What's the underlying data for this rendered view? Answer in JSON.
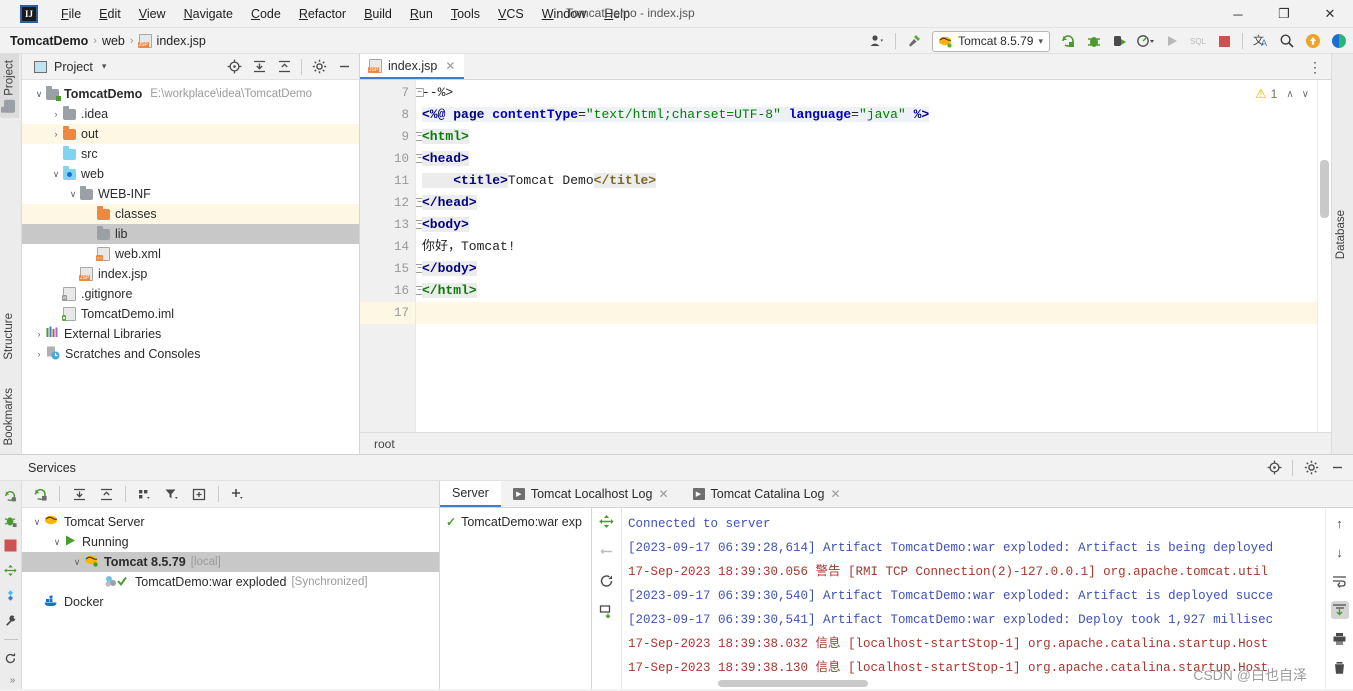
{
  "window": {
    "title": "TomcatDemo - index.jsp",
    "minimize": "─",
    "maximize": "❐",
    "close": "✕",
    "logo_text": "IJ"
  },
  "menubar": {
    "items": [
      "File",
      "Edit",
      "View",
      "Navigate",
      "Code",
      "Refactor",
      "Build",
      "Run",
      "Tools",
      "VCS",
      "Window",
      "Help"
    ]
  },
  "breadcrumb": {
    "project": "TomcatDemo",
    "folder": "web",
    "file": "index.jsp",
    "separator": "›",
    "file_badge": "JSP"
  },
  "toolbar": {
    "run_config": "Tomcat 8.5.79",
    "dropdown_caret": "▾",
    "icons": [
      "user-avatar-icon",
      "hammer-build-icon",
      "rerun-icon",
      "debug-icon",
      "run-with-coverage-icon",
      "profiler-icon",
      "run-icon",
      "sql-icon",
      "stop-icon",
      "translate-icon",
      "search-everywhere-icon",
      "update-icon",
      "ide-feature-icon"
    ]
  },
  "sidebar_left": {
    "top_tab": "Project",
    "bottom_tabs": [
      "Structure",
      "Bookmarks"
    ]
  },
  "sidebar_right": {
    "tab": "Database"
  },
  "project_panel": {
    "title": "Project",
    "caret": "▾",
    "header_icons": [
      "locate-icon",
      "expand-all-icon",
      "collapse-all-icon",
      "gear-icon",
      "hide-icon"
    ],
    "tree": [
      {
        "label": "TomcatDemo",
        "path": "E:\\workplace\\idea\\TomcatDemo",
        "depth": 0,
        "twist": "∨",
        "icon": "module-folder-icon",
        "bold": true,
        "highlight": "none"
      },
      {
        "label": ".idea",
        "path": "",
        "depth": 1,
        "twist": "›",
        "icon": "folder-gray-icon",
        "bold": false,
        "highlight": "none"
      },
      {
        "label": "out",
        "path": "",
        "depth": 1,
        "twist": "›",
        "icon": "folder-orange-icon",
        "bold": false,
        "highlight": "yellow"
      },
      {
        "label": "src",
        "path": "",
        "depth": 1,
        "twist": "",
        "icon": "folder-blue-icon",
        "bold": false,
        "highlight": "none"
      },
      {
        "label": "web",
        "path": "",
        "depth": 1,
        "twist": "∨",
        "icon": "web-root-icon",
        "bold": false,
        "highlight": "none"
      },
      {
        "label": "WEB-INF",
        "path": "",
        "depth": 2,
        "twist": "∨",
        "icon": "folder-gray-icon",
        "bold": false,
        "highlight": "none"
      },
      {
        "label": "classes",
        "path": "",
        "depth": 3,
        "twist": "",
        "icon": "folder-orange-icon",
        "bold": false,
        "highlight": "yellow"
      },
      {
        "label": "lib",
        "path": "",
        "depth": 3,
        "twist": "",
        "icon": "folder-gray-icon",
        "bold": false,
        "highlight": "gray"
      },
      {
        "label": "web.xml",
        "path": "",
        "depth": 3,
        "twist": "",
        "icon": "xml-file-icon",
        "bold": false,
        "highlight": "none"
      },
      {
        "label": "index.jsp",
        "path": "",
        "depth": 2,
        "twist": "",
        "icon": "jsp-file-icon",
        "bold": false,
        "highlight": "none"
      },
      {
        "label": ".gitignore",
        "path": "",
        "depth": 1,
        "twist": "",
        "icon": "gitignore-file-icon",
        "bold": false,
        "highlight": "none"
      },
      {
        "label": "TomcatDemo.iml",
        "path": "",
        "depth": 1,
        "twist": "",
        "icon": "iml-file-icon",
        "bold": false,
        "highlight": "none"
      },
      {
        "label": "External Libraries",
        "path": "",
        "depth": 0,
        "twist": "›",
        "icon": "libraries-icon",
        "bold": false,
        "highlight": "none"
      },
      {
        "label": "Scratches and Consoles",
        "path": "",
        "depth": 0,
        "twist": "›",
        "icon": "scratches-icon",
        "bold": false,
        "highlight": "none"
      }
    ]
  },
  "editor": {
    "tab_label": "index.jsp",
    "tab_close": "✕",
    "tab_badge": "JSP",
    "warning_count": "1",
    "warning_icon": "⚠",
    "nav_up": "∧",
    "nav_down": "∨",
    "more_icon": "⋮",
    "status_text": "root",
    "lines": [
      {
        "num": "7",
        "fold": "−",
        "current": false,
        "segments": [
          {
            "text": "--%>",
            "cls": "c-plain"
          }
        ]
      },
      {
        "num": "8",
        "fold": "",
        "current": false,
        "segments": [
          {
            "text": "<%@ ",
            "cls": "c-tag hlblock"
          },
          {
            "text": "page ",
            "cls": "c-tag hlblock"
          },
          {
            "text": "contentType",
            "cls": "c-attr hlblock"
          },
          {
            "text": "=",
            "cls": "c-plain hlblock"
          },
          {
            "text": "\"text/html;charset=UTF-8\"",
            "cls": "c-str hlblock"
          },
          {
            "text": " ",
            "cls": "c-plain hlblock"
          },
          {
            "text": "language",
            "cls": "c-attr hlblock"
          },
          {
            "text": "=",
            "cls": "c-plain hlblock"
          },
          {
            "text": "\"java\"",
            "cls": "c-str hlblock"
          },
          {
            "text": " %>",
            "cls": "c-tag hlblock"
          }
        ]
      },
      {
        "num": "9",
        "fold": "−",
        "current": false,
        "segments": [
          {
            "text": "<html>",
            "cls": "c-html hlblock2"
          }
        ]
      },
      {
        "num": "10",
        "fold": "−",
        "current": false,
        "segments": [
          {
            "text": "<head>",
            "cls": "c-tag hlblock2"
          }
        ]
      },
      {
        "num": "11",
        "fold": "",
        "current": false,
        "segments": [
          {
            "text": "    ",
            "cls": "c-plain hlblock2"
          },
          {
            "text": "<title>",
            "cls": "c-tag hlblock2"
          },
          {
            "text": "Tomcat Demo",
            "cls": "c-plain"
          },
          {
            "text": "</title>",
            "cls": "c-title hlblock2"
          }
        ]
      },
      {
        "num": "12",
        "fold": "−",
        "current": false,
        "segments": [
          {
            "text": "</head>",
            "cls": "c-tag hlblock2"
          }
        ]
      },
      {
        "num": "13",
        "fold": "−",
        "current": false,
        "segments": [
          {
            "text": "<body>",
            "cls": "c-tag hlblock2"
          }
        ]
      },
      {
        "num": "14",
        "fold": "",
        "current": false,
        "segments": [
          {
            "text": "你好，Tomcat!",
            "cls": "c-plain"
          }
        ]
      },
      {
        "num": "15",
        "fold": "−",
        "current": false,
        "segments": [
          {
            "text": "</body>",
            "cls": "c-tag hlblock2"
          }
        ]
      },
      {
        "num": "16",
        "fold": "−",
        "current": false,
        "segments": [
          {
            "text": "</html>",
            "cls": "c-html hlblock2"
          }
        ]
      },
      {
        "num": "17",
        "fold": "",
        "current": true,
        "segments": [
          {
            "text": "",
            "cls": "c-plain"
          }
        ]
      }
    ]
  },
  "services": {
    "title": "Services",
    "header_icons": [
      "locate-icon",
      "gear-icon",
      "hide-icon"
    ],
    "vstrip_icons": [
      "rerun-icon",
      "debug-icon",
      "stop-icon",
      "deploy-icon",
      "dashboard-icon",
      "settings-wrench-icon",
      "refresh-icon",
      "expand-icon"
    ],
    "toolbar_icons": [
      "rerun-icon",
      "expand-all-icon",
      "collapse-all-icon",
      "group-icon",
      "filter-icon",
      "new-tab-icon",
      "add-icon"
    ],
    "tree": [
      {
        "label": "Tomcat Server",
        "suffix": "",
        "depth": 0,
        "twist": "∨",
        "icon": "tomcat-icon",
        "bold": false,
        "selected": false
      },
      {
        "label": "Running",
        "suffix": "",
        "depth": 1,
        "twist": "∨",
        "icon": "running-play-icon",
        "bold": false,
        "selected": false
      },
      {
        "label": "Tomcat 8.5.79",
        "suffix": "[local]",
        "depth": 2,
        "twist": "∨",
        "icon": "tomcat-running-icon",
        "bold": true,
        "selected": true
      },
      {
        "label": "TomcatDemo:war exploded",
        "suffix": "[Synchronized]",
        "depth": 3,
        "twist": "",
        "icon": "artifact-ok-icon",
        "bold": false,
        "selected": false
      },
      {
        "label": "Docker",
        "suffix": "",
        "depth": 0,
        "twist": "",
        "icon": "docker-icon",
        "bold": false,
        "selected": false
      }
    ]
  },
  "console": {
    "tabs": [
      {
        "label": "Server",
        "active": true,
        "closable": false,
        "has_play": false
      },
      {
        "label": "Tomcat Localhost Log",
        "active": false,
        "closable": true,
        "has_play": true
      },
      {
        "label": "Tomcat Catalina Log",
        "active": false,
        "closable": true,
        "has_play": true
      }
    ],
    "left_item": "TomcatDemo:war exp",
    "vtools_icons": [
      "deploy-icon",
      "undeploy-icon",
      "restart-icon",
      "redeploy-icon"
    ],
    "right_icons": [
      "scroll-up-icon",
      "scroll-down-icon",
      "soft-wrap-icon",
      "scroll-to-end-icon",
      "print-icon",
      "delete-icon"
    ],
    "log_lines": [
      {
        "text": "Connected to server",
        "cls": "lg-blue"
      },
      {
        "text": "[2023-09-17 06:39:28,614] Artifact TomcatDemo:war exploded: Artifact is being deployed",
        "cls": "lg-blue"
      },
      {
        "text": "17-Sep-2023 18:39:30.056 警告 [RMI TCP Connection(2)-127.0.0.1] org.apache.tomcat.util",
        "cls": "lg-red"
      },
      {
        "text": "[2023-09-17 06:39:30,540] Artifact TomcatDemo:war exploded: Artifact is deployed succe",
        "cls": "lg-blue"
      },
      {
        "text": "[2023-09-17 06:39:30,541] Artifact TomcatDemo:war exploded: Deploy took 1,927 millisec",
        "cls": "lg-blue"
      },
      {
        "text": "17-Sep-2023 18:39:38.032 信息 [localhost-startStop-1] org.apache.catalina.startup.Host",
        "cls": "lg-red"
      },
      {
        "text": "17-Sep-2023 18:39:38.130 信息 [localhost-startStop-1] org.apache.catalina.startup.Host",
        "cls": "lg-red"
      }
    ]
  },
  "watermark": "CSDN @白也自泽",
  "colors": {
    "accent_blue": "#3e7bd4",
    "tomcat_green": "#4a9b2f",
    "warning_yellow": "#e8c020",
    "stop_red": "#cc5252",
    "highlight_yellow": "#fdf7e3",
    "selection_gray": "#c8c8c8"
  }
}
